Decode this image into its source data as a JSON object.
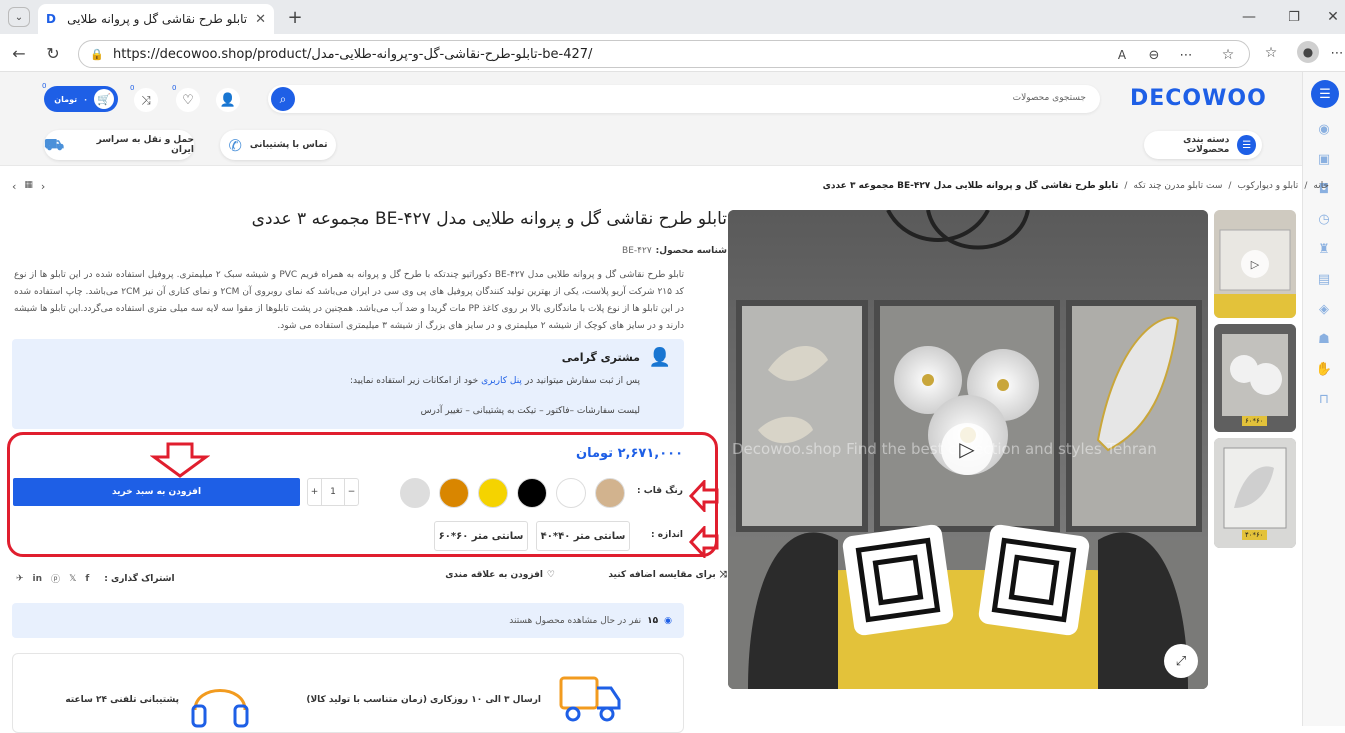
{
  "browser": {
    "tab_title": "تابلو طرح نقاشی گل و پروانه طلایی",
    "tab_favicon": "D",
    "url": "https://decowoo.shop/product/تابلو-طرح-نقاشی-گل-و-پروانه-طلایی-مدل-be-427/"
  },
  "header": {
    "logo": "DECOWOO",
    "search_placeholder": "جستجوی محصولات",
    "cart_amount": "۰",
    "cart_currency": "تومان",
    "badge_count": "0",
    "categories_label": "دسته بندی محصولات",
    "contact_label": "تماس با پشتیبانی",
    "shipping_label": "حمل و نقل به سراسر ایران"
  },
  "breadcrumb": {
    "items": [
      "خانه",
      "تابلو و دیوارکوب",
      "ست تابلو مدرن چند تکه"
    ],
    "current": "تابلو طرح نقاشی گل و پروانه طلایی مدل BE-۴۲۷ مجموعه ۳ عددی",
    "sep": "/"
  },
  "product": {
    "title": "تابلو طرح نقاشی گل و پروانه طلایی مدل BE-۴۲۷ مجموعه ۳ عددی",
    "sku_label": "شناسه محصول:",
    "sku": "BE-۴۲۷",
    "description": "تابلو طرح نقاشی گل و پروانه طلایی مدل BE-۴۲۷ دکوراتیو چندتکه با طرح گل و پروانه به همراه فریم PVC و شیشه سبک ۲ میلیمتری. پروفیل استفاده شده در این تابلو ها از نوع کد ۲۱۵ شرکت آریو پلاست، یکی از بهترین تولید کنندگان پروفیل های پی وی سی در ایران می‌باشد که نمای روبروی آن ۲CM و نمای کناری آن نیز ۲CM می‌باشد. چاپ استفاده شده در این تابلو ها از نوع پلات با ماندگاری بالا بر روی کاغذ PP مات گریدا و ضد آب می‌باشد. همچنین در پشت تابلوها از مقوا سه لایه سه میلی متری استفاده می‌گردد.این تابلو ها شیشه دارند و در سایز های کوچک از شیشه ۲ میلیمتری و در سایز های بزرگ از شیشه ۳ میلیمتری استفاده می شود.",
    "price": "۲,۶۷۱,۰۰۰ تومان",
    "color_label": "رنگ قاب :",
    "colors": [
      "#d2b38e",
      "#ffffff",
      "#000000",
      "#f5d300",
      "#d98600",
      "#dddddd"
    ],
    "size_label": "اندازه :",
    "sizes": [
      "۴۰*۴۰ سانتی متر",
      "۶۰*۶۰ سانتی متر"
    ],
    "qty": "1",
    "qty_minus": "−",
    "qty_plus": "+",
    "add_to_cart": "افزودن به سبد خرید",
    "compare": "برای مقایسه اضافه کنید",
    "wishlist": "افزودن به علاقه مندی",
    "share_label": "اشتراک گذاری :",
    "viewers_count": "۱۵",
    "viewers_text": "نفر در حال مشاهده محصول هستند",
    "watermark": "Decowoo.shop Find the best collection and styles Tehran"
  },
  "customer_box": {
    "title": "مشتری گرامی",
    "line1_pre": "پس از ثبت سفارش میتوانید در",
    "line1_link": "پنل کاربری",
    "line1_post": "خود از امکانات زیر استفاده نمایید:",
    "line2": "لیست سفارشات –فاکتور – تیکت به پشتیبانی – تغییر آدرس"
  },
  "features": {
    "shipping": "ارسال ۳ الی ۱۰ روزکاری (زمان متناسب با تولید کالا)",
    "support": "پشتیبانی تلفنی ۲۴ ساعته"
  },
  "thumbnails": [
    "",
    "۶۰*۶۰",
    "۴۰*۶۰"
  ],
  "colors": {
    "accent": "#1e5fe6",
    "annotation": "#e01e2e",
    "info_bg": "#e8f0fd",
    "sofa": "#e3c23a"
  }
}
